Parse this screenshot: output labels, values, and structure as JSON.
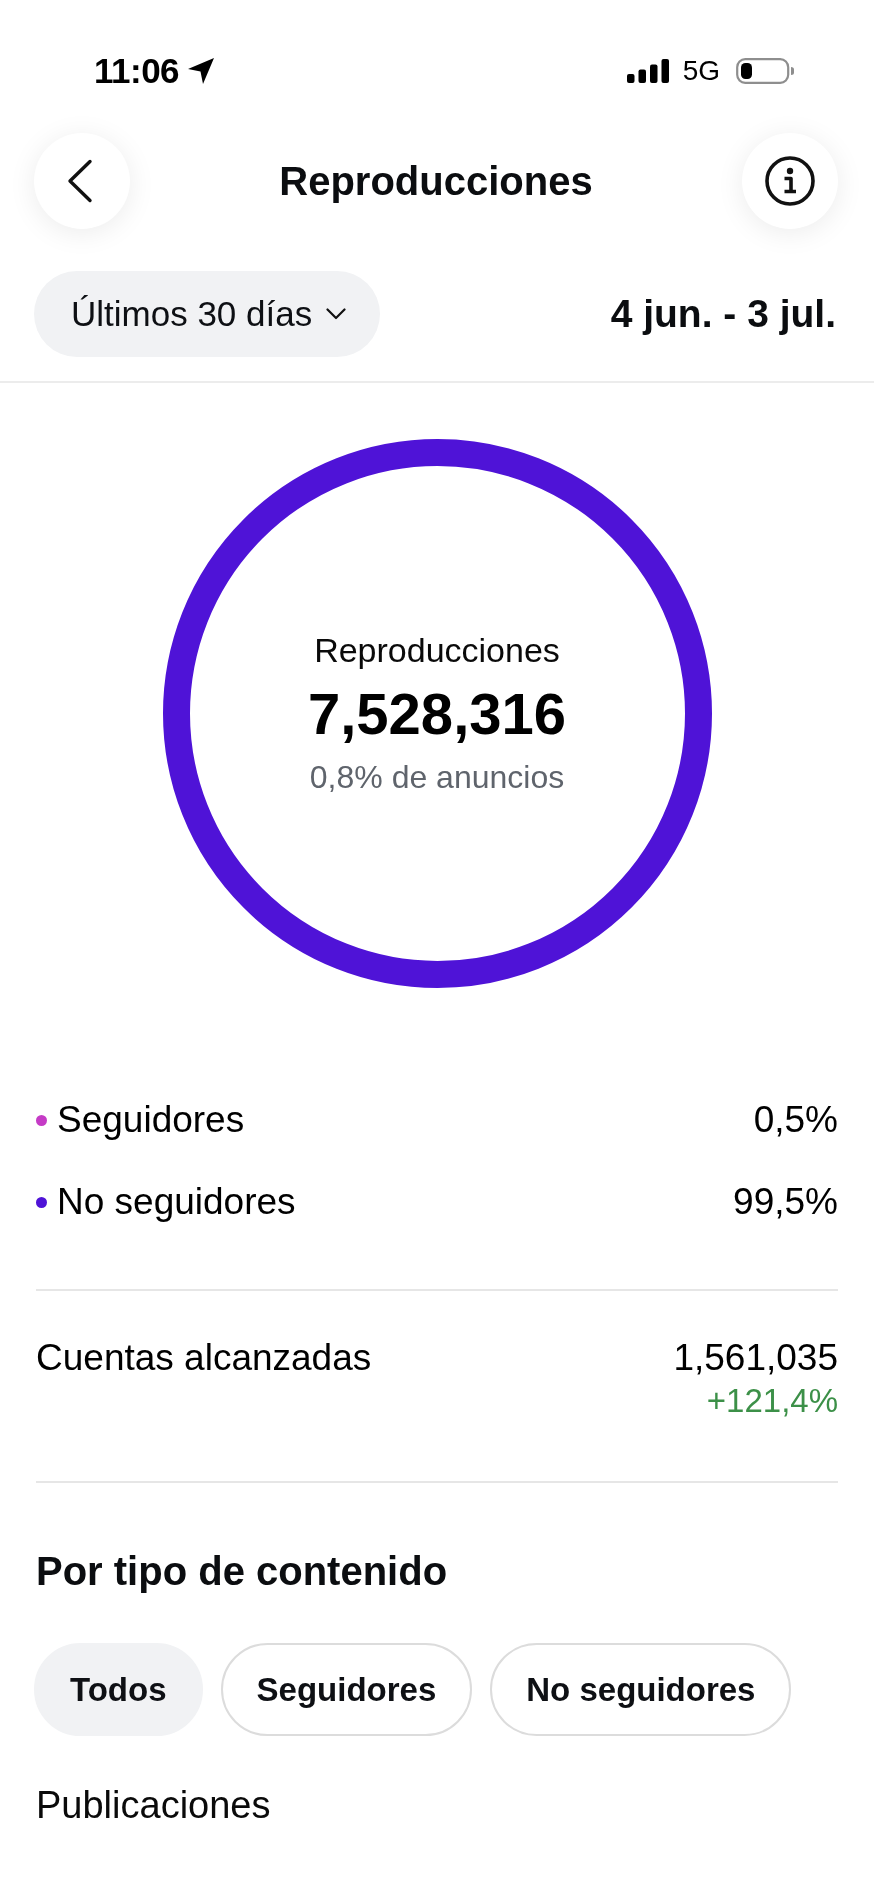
{
  "status_bar": {
    "time": "11:06",
    "network": "5G"
  },
  "header": {
    "title": "Reproducciones"
  },
  "period": {
    "label": "Últimos 30 días",
    "range": "4 jun. - 3 jul."
  },
  "summary": {
    "label": "Reproducciones",
    "value": "7,528,316",
    "note": "0,8% de anuncios"
  },
  "legend": [
    {
      "label": "Seguidores",
      "value": "0,5%",
      "color": "#c53bc6"
    },
    {
      "label": "No seguidores",
      "value": "99,5%",
      "color": "#4f13d7"
    }
  ],
  "reach": {
    "label": "Cuentas alcanzadas",
    "value": "1,561,035",
    "change": "+121,4%",
    "increase": true
  },
  "content_type": {
    "title": "Por tipo de contenido",
    "filters": [
      {
        "label": "Todos",
        "selected": true
      },
      {
        "label": "Seguidores",
        "selected": false
      },
      {
        "label": "No seguidores",
        "selected": false
      }
    ]
  },
  "section": {
    "label": "Publicaciones"
  }
}
